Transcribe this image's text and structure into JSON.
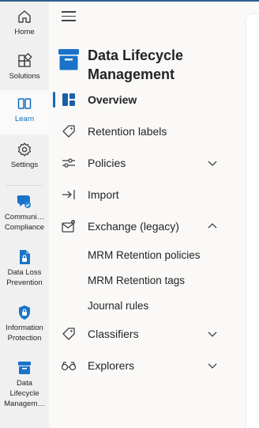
{
  "rail": {
    "items": [
      {
        "label": "Home",
        "icon": "home-icon"
      },
      {
        "label": "Solutions",
        "icon": "solutions-icon"
      },
      {
        "label": "Learn",
        "icon": "learn-icon",
        "active": true
      },
      {
        "label": "Settings",
        "icon": "settings-icon"
      },
      {
        "label": "Communi…\nCompliance",
        "icon": "communication-compliance-icon"
      },
      {
        "label": "Data Loss\nPrevention",
        "icon": "data-loss-prevention-icon"
      },
      {
        "label": "Information\nProtection",
        "icon": "information-protection-icon"
      },
      {
        "label": "Data\nLifecycle\nManagem…",
        "icon": "data-lifecycle-icon"
      }
    ]
  },
  "nav": {
    "title": "Data Lifecycle Management",
    "items": [
      {
        "label": "Overview",
        "icon": "overview-icon",
        "selected": true
      },
      {
        "label": "Retention labels",
        "icon": "tag-icon"
      },
      {
        "label": "Policies",
        "icon": "policies-icon",
        "chevron": "down"
      },
      {
        "label": "Import",
        "icon": "import-icon"
      },
      {
        "label": "Exchange (legacy)",
        "icon": "exchange-icon",
        "chevron": "up"
      },
      {
        "label": "MRM Retention policies"
      },
      {
        "label": "MRM Retention tags"
      },
      {
        "label": "Journal rules"
      },
      {
        "label": "Classifiers",
        "icon": "classifiers-icon",
        "chevron": "down"
      },
      {
        "label": "Explorers",
        "icon": "explorers-icon",
        "chevron": "down"
      }
    ]
  },
  "colors": {
    "accent": "#0f6cbd",
    "rail_bg": "#f0f0f0",
    "nav_bg": "#faf9f8"
  }
}
